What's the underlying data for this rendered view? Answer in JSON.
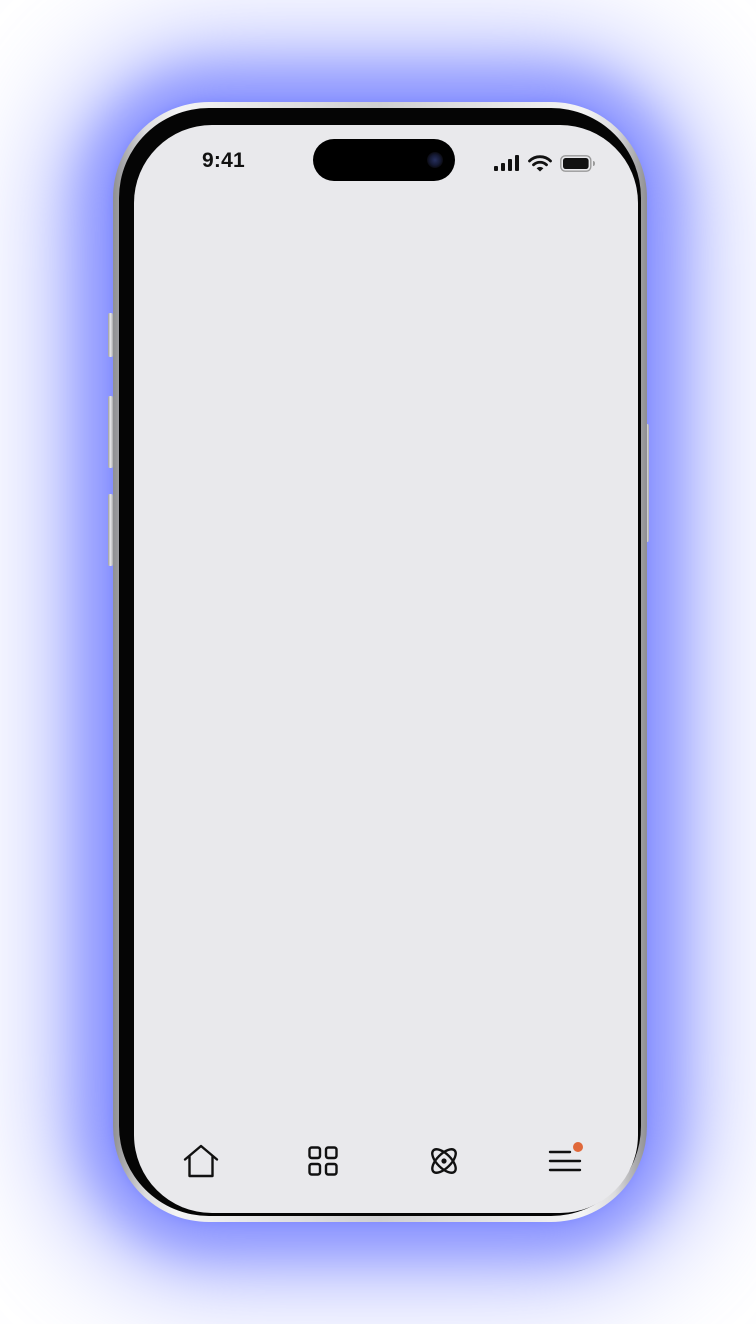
{
  "status_bar": {
    "time": "9:41",
    "icons": [
      "cellular-signal-icon",
      "wifi-icon",
      "battery-icon"
    ]
  },
  "device": {
    "glow_color": "#7b86ff",
    "screen_color": "#e9e9ec"
  },
  "tab_bar": {
    "items": [
      {
        "icon": "home-icon"
      },
      {
        "icon": "grid-icon"
      },
      {
        "icon": "atom-icon"
      },
      {
        "icon": "menu-icon",
        "has_notification": true
      }
    ],
    "notification_color": "#e0683a"
  }
}
